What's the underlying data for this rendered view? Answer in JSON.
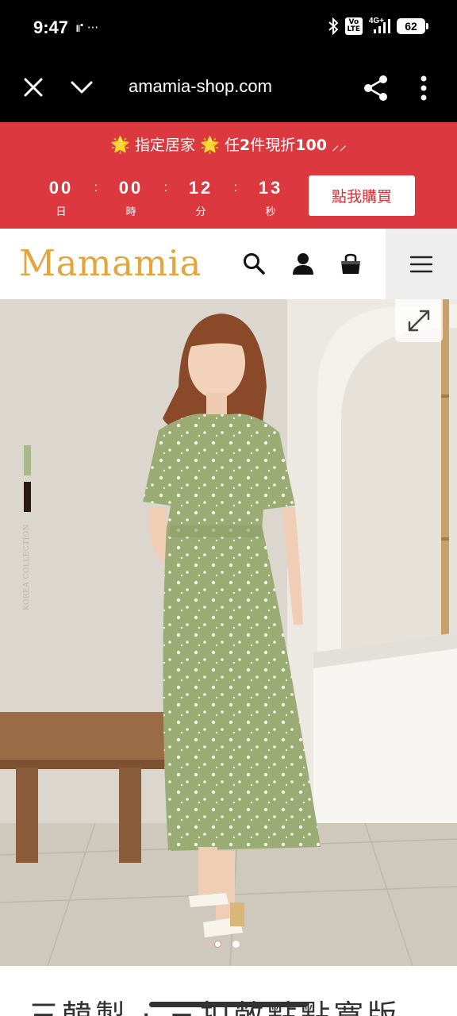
{
  "status_bar": {
    "time": "9:47",
    "extra": "⑈ ···",
    "network": "4G+",
    "volte": "Vo LTE",
    "battery": "62"
  },
  "browser": {
    "url": "amamia-shop.com",
    "icons": [
      "close-icon",
      "chevron-down-icon",
      "share-icon",
      "more-vert-icon"
    ]
  },
  "promo": {
    "text_prefix": "指定居家",
    "text_mid": "任",
    "text_bold1": "2",
    "text_mid2": "件現折",
    "text_bold2": "100",
    "text_suffix": " ⸝⸝",
    "star": "🌟",
    "countdown": [
      {
        "value": "00",
        "label": "日"
      },
      {
        "value": "00",
        "label": "時"
      },
      {
        "value": "12",
        "label": "分"
      },
      {
        "value": "13",
        "label": "秒"
      }
    ],
    "separator": ":",
    "buy_label": "點我購買",
    "colors": {
      "background": "#db393f",
      "button_text": "#d5323a"
    }
  },
  "header": {
    "logo": "Mamamia",
    "logo_color": "#e4a53a",
    "icons": [
      "search-icon",
      "user-icon",
      "shopping-bag-icon",
      "hamburger-menu-icon"
    ]
  },
  "product_photo": {
    "collection_label": "KOREA COLLECTION",
    "swatches": [
      "#a8b889",
      "#2b1a12"
    ],
    "carousel": {
      "current": 1,
      "total": 2
    }
  },
  "product": {
    "title_partial": "三韓製 ‧ 三扣敞點點寬版"
  }
}
